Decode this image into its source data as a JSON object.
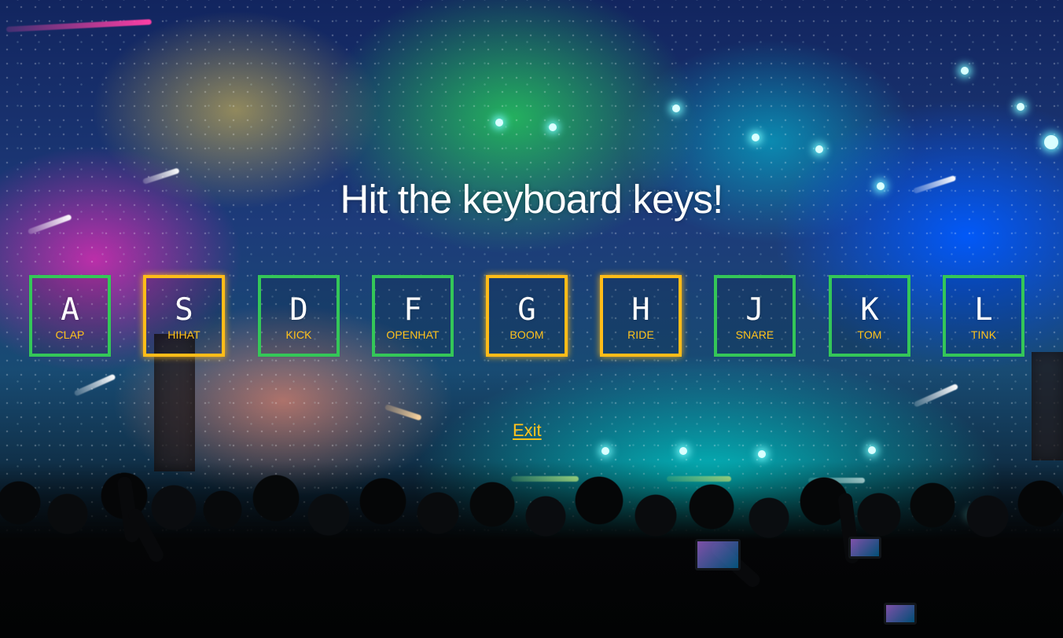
{
  "title": "Hit the keyboard keys!",
  "keys": [
    {
      "letter": "A",
      "sound": "CLAP",
      "state": "default"
    },
    {
      "letter": "S",
      "sound": "HIHAT",
      "state": "active"
    },
    {
      "letter": "D",
      "sound": "KICK",
      "state": "default"
    },
    {
      "letter": "F",
      "sound": "OPENHAT",
      "state": "default"
    },
    {
      "letter": "G",
      "sound": "BOOM",
      "state": "active"
    },
    {
      "letter": "H",
      "sound": "RIDE",
      "state": "active"
    },
    {
      "letter": "J",
      "sound": "SNARE",
      "state": "default"
    },
    {
      "letter": "K",
      "sound": "TOM",
      "state": "default"
    },
    {
      "letter": "L",
      "sound": "TINK",
      "state": "default"
    }
  ],
  "exit_label": "Exit",
  "colors": {
    "default_border": "#34c758",
    "active_border": "#ffbc18",
    "sound_label": "#ffc21c",
    "title_text": "#ffffff"
  }
}
